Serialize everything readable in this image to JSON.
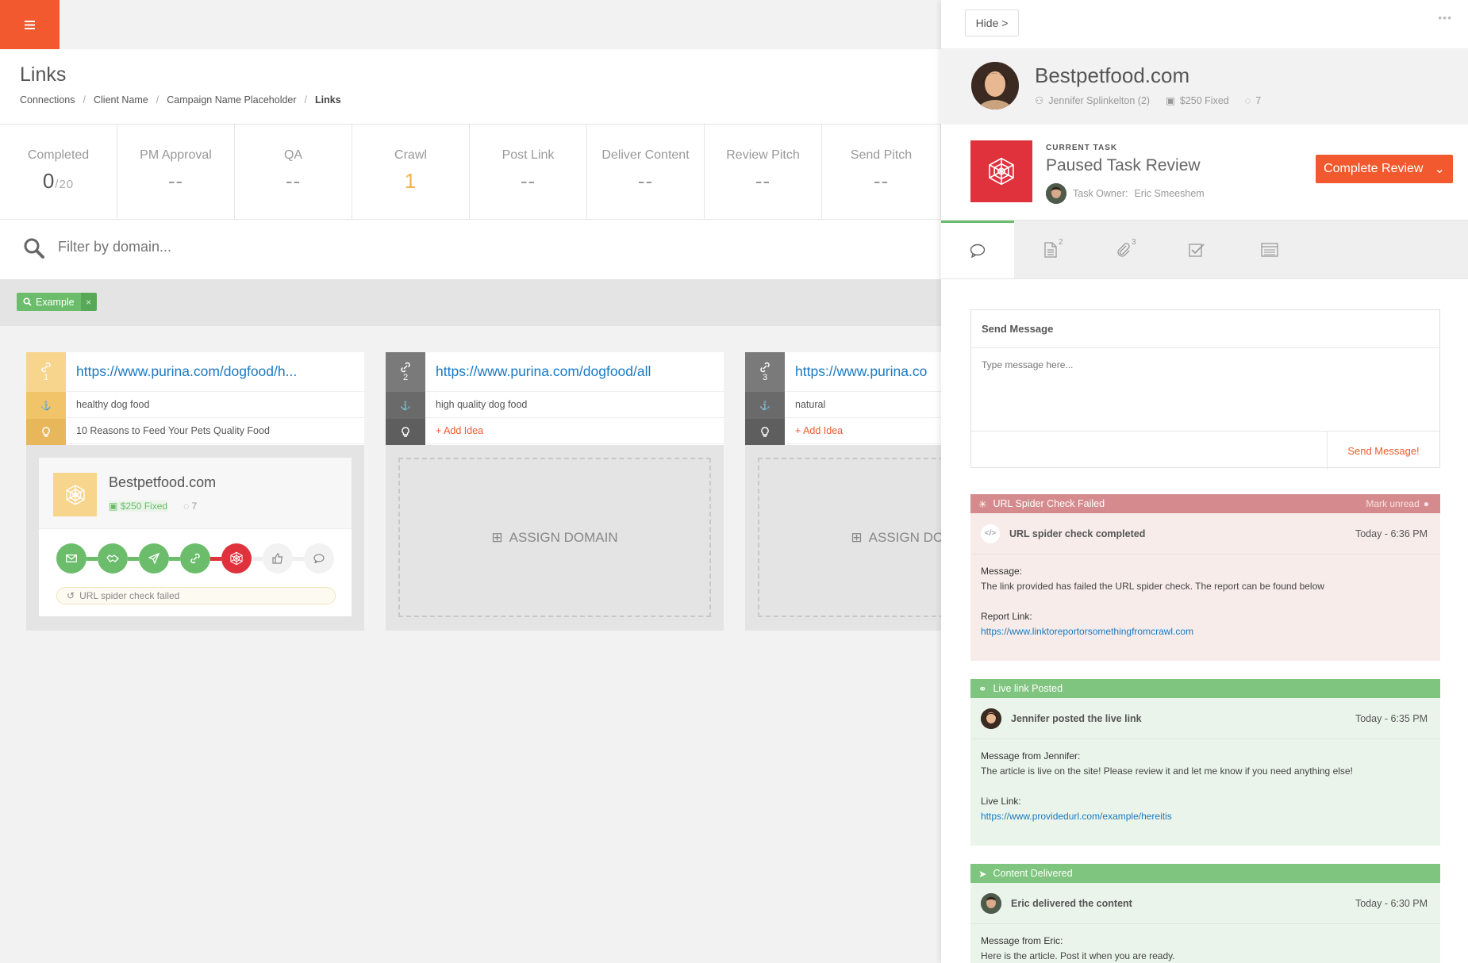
{
  "header": {
    "title": "Links",
    "breadcrumb": [
      "Connections",
      "Client Name",
      "Campaign Name Placeholder",
      "Links"
    ]
  },
  "stats": [
    {
      "label": "Completed",
      "value": "0",
      "suffix": "/20"
    },
    {
      "label": "PM Approval",
      "value": "--"
    },
    {
      "label": "QA",
      "value": "--"
    },
    {
      "label": "Crawl",
      "value": "1"
    },
    {
      "label": "Post Link",
      "value": "--"
    },
    {
      "label": "Deliver Content",
      "value": "--"
    },
    {
      "label": "Review Pitch",
      "value": "--"
    },
    {
      "label": "Send Pitch",
      "value": "--"
    }
  ],
  "filter": {
    "placeholder": "Filter by domain..."
  },
  "tag": {
    "label": "Example",
    "remove": "×"
  },
  "columns": [
    {
      "index": "1",
      "url": "https://www.purina.com/dogfood/h...",
      "anchor": "healthy dog food",
      "idea": "10 Reasons to Feed Your Pets Quality Food",
      "domain": {
        "name": "Bestpetfood.com",
        "price": "$250 Fixed",
        "comments": "7"
      },
      "status": "URL spider check failed"
    },
    {
      "index": "2",
      "url": "https://www.purina.com/dogfood/all",
      "anchor": "high quality dog food",
      "idea": "+ Add Idea",
      "assign": "ASSIGN DOMAIN"
    },
    {
      "index": "3",
      "url": "https://www.purina.co",
      "anchor": "natural",
      "idea": "+ Add Idea",
      "assign": "ASSIGN DOMAIN"
    }
  ],
  "panel": {
    "hide_label": "Hide >",
    "client_name": "Bestpetfood.com",
    "contact": "Jennifer Splinkelton (2)",
    "price": "$250 Fixed",
    "comments": "7",
    "task_kicker": "CURRENT TASK",
    "task_title": "Paused Task Review",
    "task_owner_label": "Task Owner:",
    "task_owner": "Eric Smeeshem",
    "complete_label": "Complete Review",
    "tabs": [
      {
        "name": "comments",
        "count": ""
      },
      {
        "name": "documents",
        "count": "2"
      },
      {
        "name": "attachments",
        "count": "3"
      },
      {
        "name": "checklist",
        "count": ""
      },
      {
        "name": "details",
        "count": ""
      }
    ],
    "send": {
      "title": "Send Message",
      "placeholder": "Type message here...",
      "button": "Send Message!"
    },
    "events": [
      {
        "header": "URL Spider Check Failed",
        "mark_unread": "Mark unread",
        "title": "URL spider check completed",
        "time": "Today - 6:36 PM",
        "label1": "Message:",
        "text1": "The link provided has failed the URL spider check. The report can be found below",
        "label2": "Report Link:",
        "link": "https://www.linktoreportorsomethingfromcrawl.com"
      },
      {
        "header": "Live link Posted",
        "title": "Jennifer posted the live link",
        "time": "Today - 6:35 PM",
        "label1": "Message from Jennifer:",
        "text1": "The article is live on the site! Please review it and let me know if you need anything else!",
        "label2": "Live Link:",
        "link": "https://www.providedurl.com/example/hereitis"
      },
      {
        "header": "Content Delivered",
        "title": "Eric delivered the content",
        "time": "Today - 6:30 PM",
        "label1": "Message from Eric:",
        "text1": "Here is the article. Post it when you are ready."
      }
    ]
  },
  "colors": {
    "accent": "#f2592e",
    "green": "#6bbd6b",
    "red": "#e0323d",
    "yellow": "#f8d58c",
    "link": "#1a7ac2"
  }
}
